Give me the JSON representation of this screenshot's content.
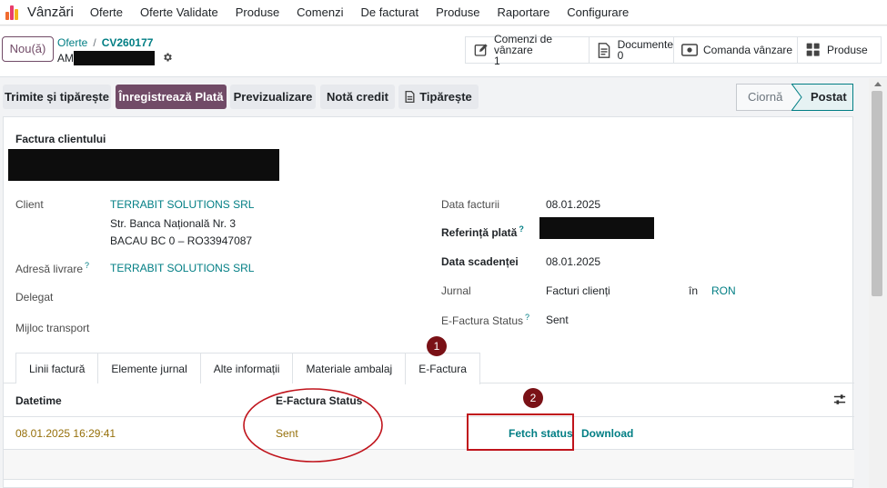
{
  "navbar": {
    "app_title": "Vânzări",
    "items": [
      "Oferte",
      "Oferte Validate",
      "Produse",
      "Comenzi",
      "De facturat",
      "Produse",
      "Raportare",
      "Configurare"
    ]
  },
  "control": {
    "new_label": "Nou(ă)",
    "breadcrumb_parent": "Oferte",
    "breadcrumb_separator": "/",
    "breadcrumb_current": "CV260177",
    "record_prefix": "AM",
    "smart_buttons": [
      {
        "label": "Comenzi de vânzare",
        "count": "1",
        "icon": "edit-icon"
      },
      {
        "label": "Documente",
        "count": "0",
        "icon": "document-icon"
      },
      {
        "label": "Comanda vânzare",
        "count": "",
        "icon": "money-icon"
      },
      {
        "label": "Produse",
        "count": "",
        "icon": "grid-icon"
      }
    ]
  },
  "statusbar": {
    "buttons": [
      "Trimite și tipărește",
      "Înregistrează Plată",
      "Previzualizare",
      "Notă credit",
      "Tipărește"
    ],
    "stages": [
      "Ciornă",
      "Postat"
    ],
    "current_stage": "Postat"
  },
  "form": {
    "title_label": "Factura clientului",
    "client_label": "Client",
    "client_name": "TERRABIT SOLUTIONS SRL",
    "client_street": "Str. Banca Națională Nr. 3",
    "client_city": "BACAU BC 0 – RO33947087",
    "delivery_label": "Adresă livrare",
    "delivery_value": "TERRABIT SOLUTIONS SRL",
    "delegate_label": "Delegat",
    "transport_label": "Mijloc transport",
    "invoice_date_label": "Data facturii",
    "invoice_date": "08.01.2025",
    "payment_ref_label": "Referință plată",
    "due_date_label": "Data scadenței",
    "due_date": "08.01.2025",
    "journal_label": "Jurnal",
    "journal_value": "Facturi clienți",
    "currency_in": "în",
    "currency": "RON",
    "efactura_status_label": "E-Factura Status",
    "efactura_status": "Sent",
    "help_mark": "?"
  },
  "tabs": [
    "Linii factură",
    "Elemente jurnal",
    "Alte informații",
    "Materiale ambalaj",
    "E-Factura"
  ],
  "active_tab": "E-Factura",
  "table": {
    "headers": [
      "Datetime",
      "E-Factura Status"
    ],
    "rows": [
      {
        "datetime": "08.01.2025 16:29:41",
        "status": "Sent",
        "fetch_label": "Fetch status",
        "download_label": "Download"
      }
    ]
  },
  "annotations": [
    "1",
    "2"
  ],
  "colors": {
    "brand": "#714b67",
    "link": "#017e84",
    "annotation": "#c0141c",
    "row_text": "#96700b"
  }
}
